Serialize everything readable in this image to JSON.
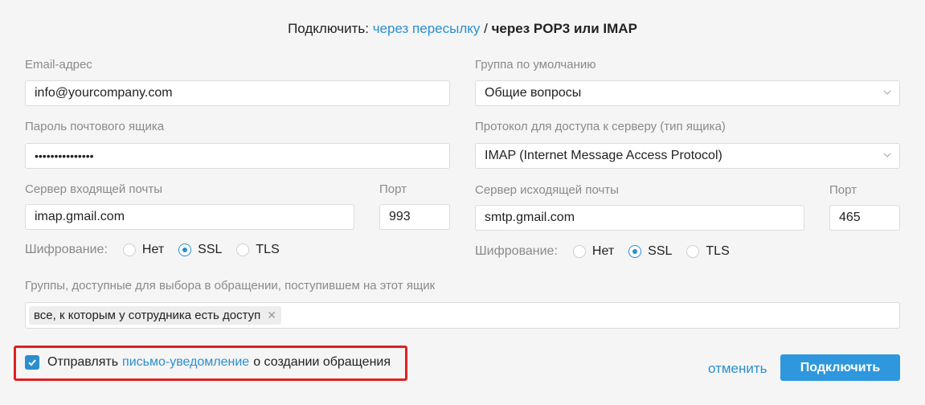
{
  "header": {
    "prefix": "Подключить:",
    "forward_link": "через пересылку",
    "separator": " / ",
    "current": "через POP3 или IMAP"
  },
  "left": {
    "email_label": "Email-адрес",
    "email_value": "info@yourcompany.com",
    "password_label": "Пароль почтового ящика",
    "password_value": "•••••••••••••••",
    "incoming_label": "Сервер входящей почты",
    "incoming_value": "imap.gmail.com",
    "port_label": "Порт",
    "port_value": "993",
    "encryption": {
      "label": "Шифрование:",
      "options": [
        "Нет",
        "SSL",
        "TLS"
      ],
      "selected": "SSL"
    }
  },
  "right": {
    "group_label": "Группа по умолчанию",
    "group_value": "Общие вопросы",
    "protocol_label": "Протокол для доступа к серверу (тип ящика)",
    "protocol_value": "IMAP (Internet Message Access Protocol)",
    "outgoing_label": "Сервер исходящей почты",
    "outgoing_value": "smtp.gmail.com",
    "port_label": "Порт",
    "port_value": "465",
    "encryption": {
      "label": "Шифрование:",
      "options": [
        "Нет",
        "SSL",
        "TLS"
      ],
      "selected": "SSL"
    }
  },
  "groups": {
    "label": "Группы, доступные для выбора в обращении, поступившем на этот ящик",
    "tag": "все, к которым у сотрудника есть доступ",
    "tag_remove": "✕"
  },
  "notify": {
    "checked": true,
    "prefix": "Отправлять",
    "link": "письмо-уведомление",
    "suffix": "о создании обращения"
  },
  "actions": {
    "cancel": "отменить",
    "connect": "Подключить"
  },
  "colors": {
    "accent": "#2a8fcf",
    "button": "#2e97de",
    "highlight": "#e02020"
  }
}
